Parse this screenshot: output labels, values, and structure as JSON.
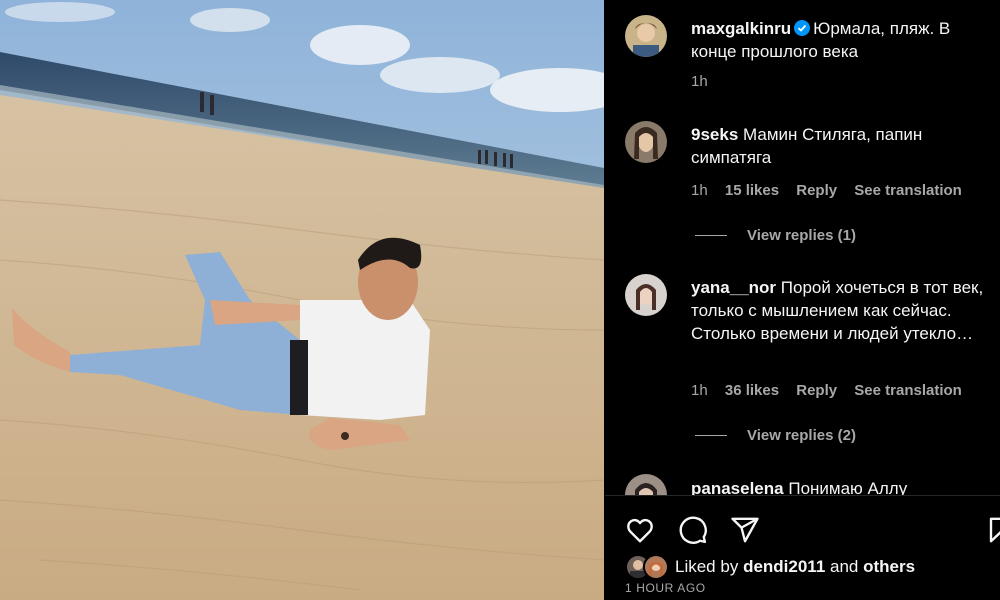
{
  "post": {
    "author": "maxgalkinru",
    "caption": "Юрмала, пляж. В конце прошлого века",
    "time": "1h"
  },
  "comments": [
    {
      "username": "9seks",
      "text": "Мамин Стиляга, папин симпатяга",
      "time": "1h",
      "likes": "15 likes",
      "reply": "Reply",
      "translate": "See translation",
      "view_replies": "View replies (1)"
    },
    {
      "username": "yana__nor",
      "text": "Порой хочеться в тот век, только с мышлением как сейчас. Столько времени и людей утекло…",
      "time": "1h",
      "likes": "36 likes",
      "reply": "Reply",
      "translate": "See translation",
      "view_replies": "View replies (2)"
    },
    {
      "username": "panaselena",
      "text": "Понимаю Аллу"
    }
  ],
  "footer": {
    "liked_prefix": "Liked by",
    "liked_user": "dendi2011",
    "liked_and": "and",
    "liked_others": "others",
    "time_ago": "1 HOUR AGO"
  },
  "icons": [
    "verified-badge-icon",
    "heart-icon",
    "comment-icon",
    "share-icon",
    "bookmark-icon"
  ],
  "colors": {
    "verified": "#0095f6",
    "muted": "#a8a8a8",
    "background": "#000000"
  }
}
